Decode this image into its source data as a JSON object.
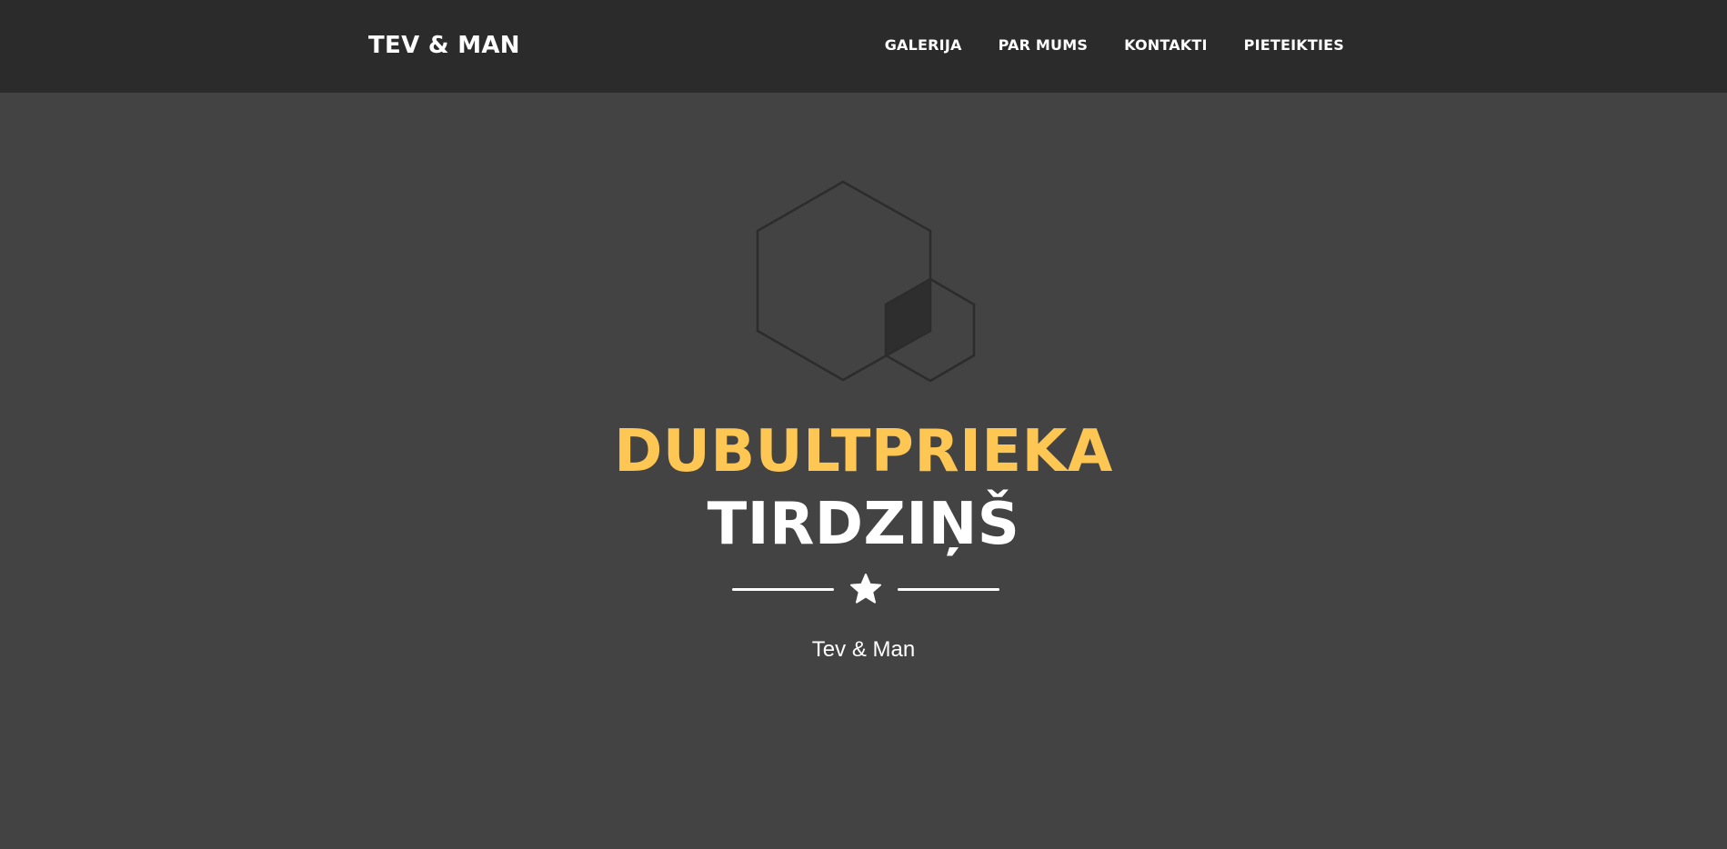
{
  "navbar": {
    "brand": "TEV & MAN",
    "links": [
      "GALERIJA",
      "PAR MUMS",
      "KONTAKTI",
      "PIETEIKTIES"
    ]
  },
  "hero": {
    "logo_icon": "hexagon-logo-icon",
    "title_line1": "DUBULTPRIEKA",
    "title_line2": "TIRDZIŅŠ",
    "divider_icon": "star-icon",
    "subtitle": "Tev & Man"
  },
  "colors": {
    "navbar_bg": "#2b2b2b",
    "hero_bg": "#434343",
    "accent": "#fec653",
    "text": "#ffffff"
  }
}
